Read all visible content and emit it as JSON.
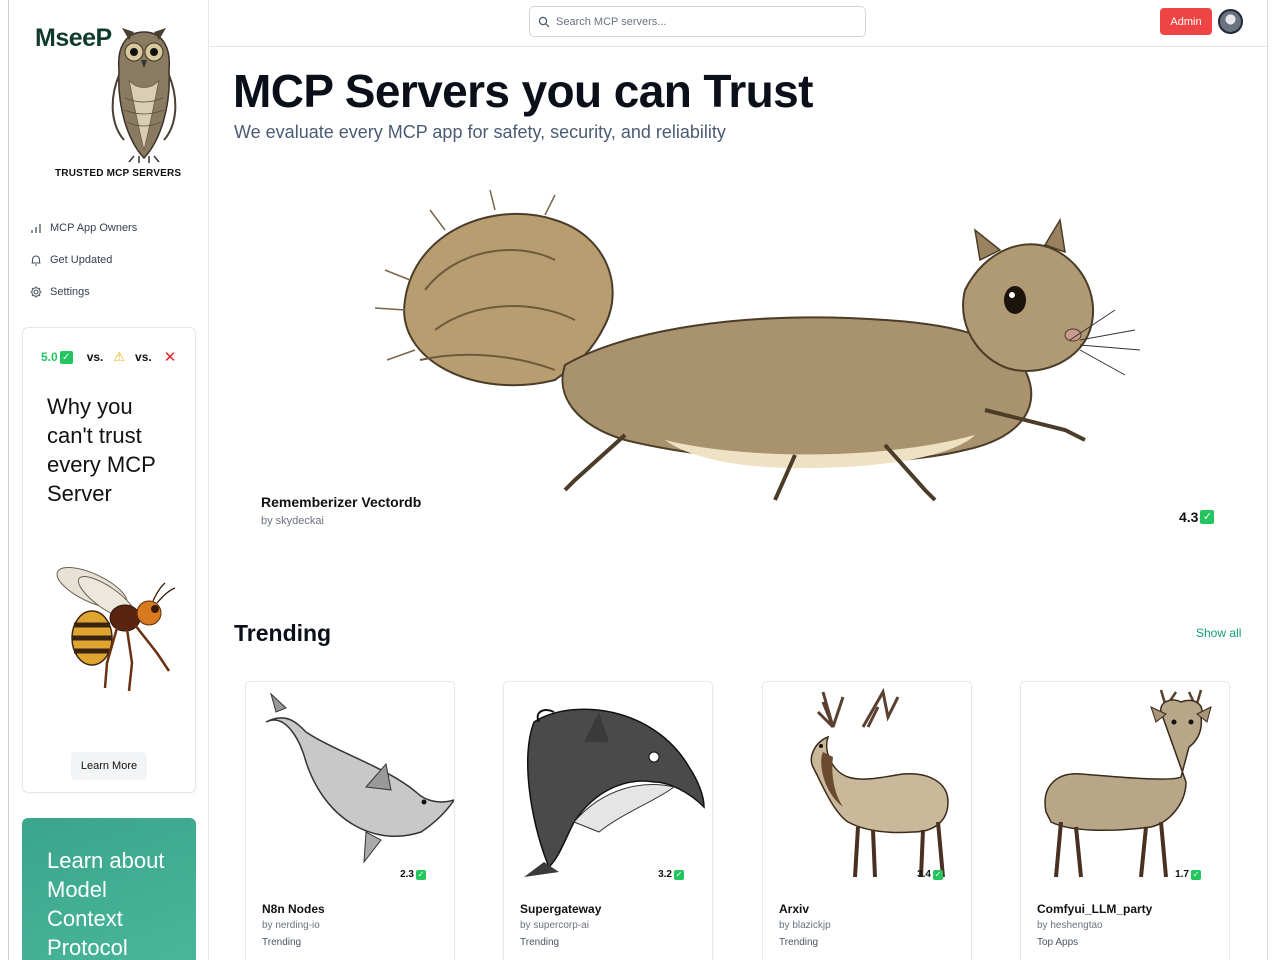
{
  "sidebar": {
    "logo_text": "MseeP",
    "logo_tagline": "TRUSTED MCP SERVERS",
    "nav": [
      {
        "label": "MCP App Owners",
        "icon": "bar-chart-icon"
      },
      {
        "label": "Get Updated",
        "icon": "bell-icon"
      },
      {
        "label": "Settings",
        "icon": "gear-icon"
      }
    ],
    "promo": {
      "score": "5.0",
      "vs1": "vs.",
      "vs2": "vs.",
      "title": "Why you can't trust every MCP Server",
      "button": "Learn More"
    },
    "mcp_card_title": "Learn about Model Context Protocol"
  },
  "topbar": {
    "search_placeholder": "Search MCP servers...",
    "admin_label": "Admin"
  },
  "hero": {
    "title": "MCP Servers you can Trust",
    "subtitle": "We evaluate every MCP app for safety, security, and reliability"
  },
  "featured": {
    "name": "Rememberizer Vectordb",
    "author": "by skydeckai",
    "rating": "4.3"
  },
  "trending": {
    "title": "Trending",
    "show_all": "Show all",
    "cards": [
      {
        "name": "N8n Nodes",
        "author": "by nerding-io",
        "tag": "Trending",
        "rating": "2.3"
      },
      {
        "name": "Supergateway",
        "author": "by supercorp-ai",
        "tag": "Trending",
        "rating": "3.2"
      },
      {
        "name": "Arxiv",
        "author": "by blazickjp",
        "tag": "Trending",
        "rating": "3.4"
      },
      {
        "name": "Comfyui_LLM_party",
        "author": "by heshengtao",
        "tag": "Top Apps",
        "rating": "1.7"
      }
    ]
  },
  "colors": {
    "accent_green": "#22c55e",
    "admin_red": "#ef4444",
    "link_teal": "#0f9d7a",
    "mcp_card": "#3aa58b"
  }
}
